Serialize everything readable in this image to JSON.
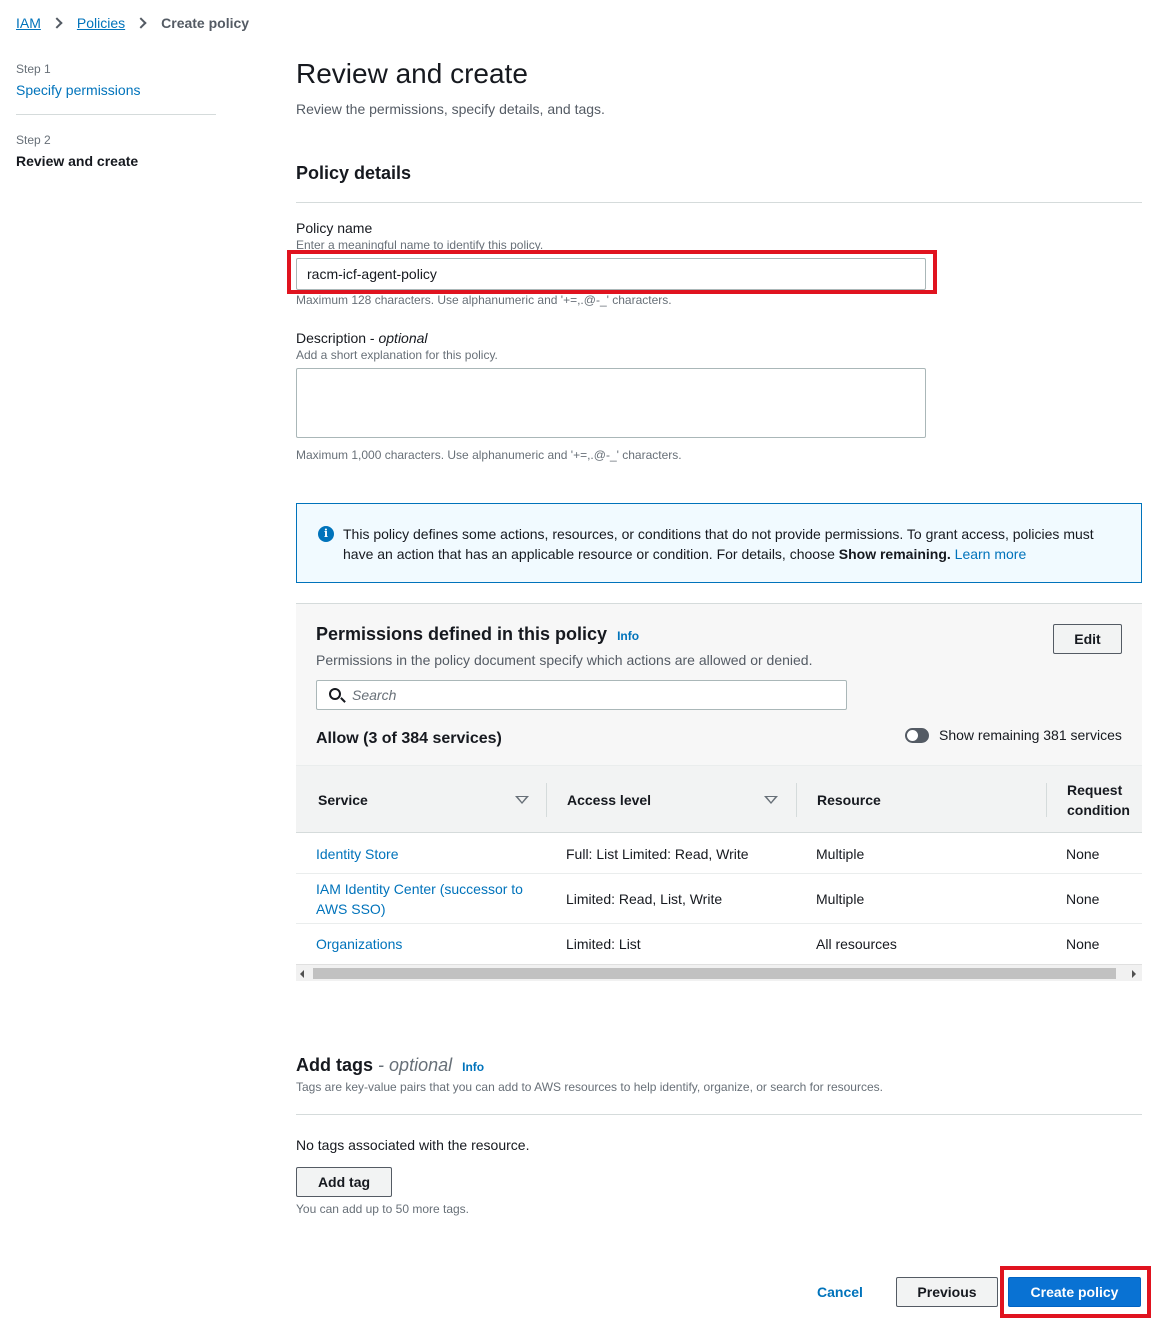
{
  "breadcrumb": {
    "items": [
      "IAM",
      "Policies"
    ],
    "current": "Create policy"
  },
  "steps": [
    {
      "num": "Step 1",
      "title": "Specify permissions"
    },
    {
      "num": "Step 2",
      "title": "Review and create"
    }
  ],
  "page": {
    "title": "Review and create",
    "subtitle": "Review the permissions, specify details, and tags."
  },
  "policy_details": {
    "title": "Policy details",
    "name_label": "Policy name",
    "name_hint": "Enter a meaningful name to identify this policy.",
    "name_value": "racm-icf-agent-policy",
    "name_constraint": "Maximum 128 characters. Use alphanumeric and '+=,.@-_' characters.",
    "desc_label": "Description",
    "desc_optional": "optional",
    "desc_hint": "Add a short explanation for this policy.",
    "desc_value": "",
    "desc_constraint": "Maximum 1,000 characters. Use alphanumeric and '+=,.@-_' characters."
  },
  "alert": {
    "text_before": "This policy defines some actions, resources, or conditions that do not provide permissions. To grant access, policies must have an action that has an applicable resource or condition. For details, choose ",
    "bold": "Show remaining.",
    "link": "Learn more"
  },
  "permissions": {
    "title": "Permissions defined in this policy",
    "info": "Info",
    "description": "Permissions in the policy document specify which actions are allowed or denied.",
    "edit_label": "Edit",
    "search_placeholder": "Search",
    "allow_title": "Allow (3 of 384 services)",
    "toggle_label": "Show remaining 381 services",
    "columns": [
      "Service",
      "Access level",
      "Resource",
      "Request condition"
    ],
    "rows": [
      {
        "service": "Identity Store",
        "access": "Full: List Limited: Read, Write",
        "resource": "Multiple",
        "condition": "None"
      },
      {
        "service": "IAM Identity Center (successor to AWS SSO)",
        "access": "Limited: Read, List, Write",
        "resource": "Multiple",
        "condition": "None"
      },
      {
        "service": "Organizations",
        "access": "Limited: List",
        "resource": "All resources",
        "condition": "None"
      }
    ]
  },
  "tags": {
    "title": "Add tags",
    "optional": "optional",
    "info": "Info",
    "description": "Tags are key-value pairs that you can add to AWS resources to help identify, organize, or search for resources.",
    "empty": "No tags associated with the resource.",
    "add_label": "Add tag",
    "limit": "You can add up to 50 more tags."
  },
  "footer": {
    "cancel": "Cancel",
    "previous": "Previous",
    "create": "Create policy"
  },
  "colors": {
    "link": "#0073bb",
    "primary": "#0972d3",
    "highlight": "#e0131f"
  }
}
